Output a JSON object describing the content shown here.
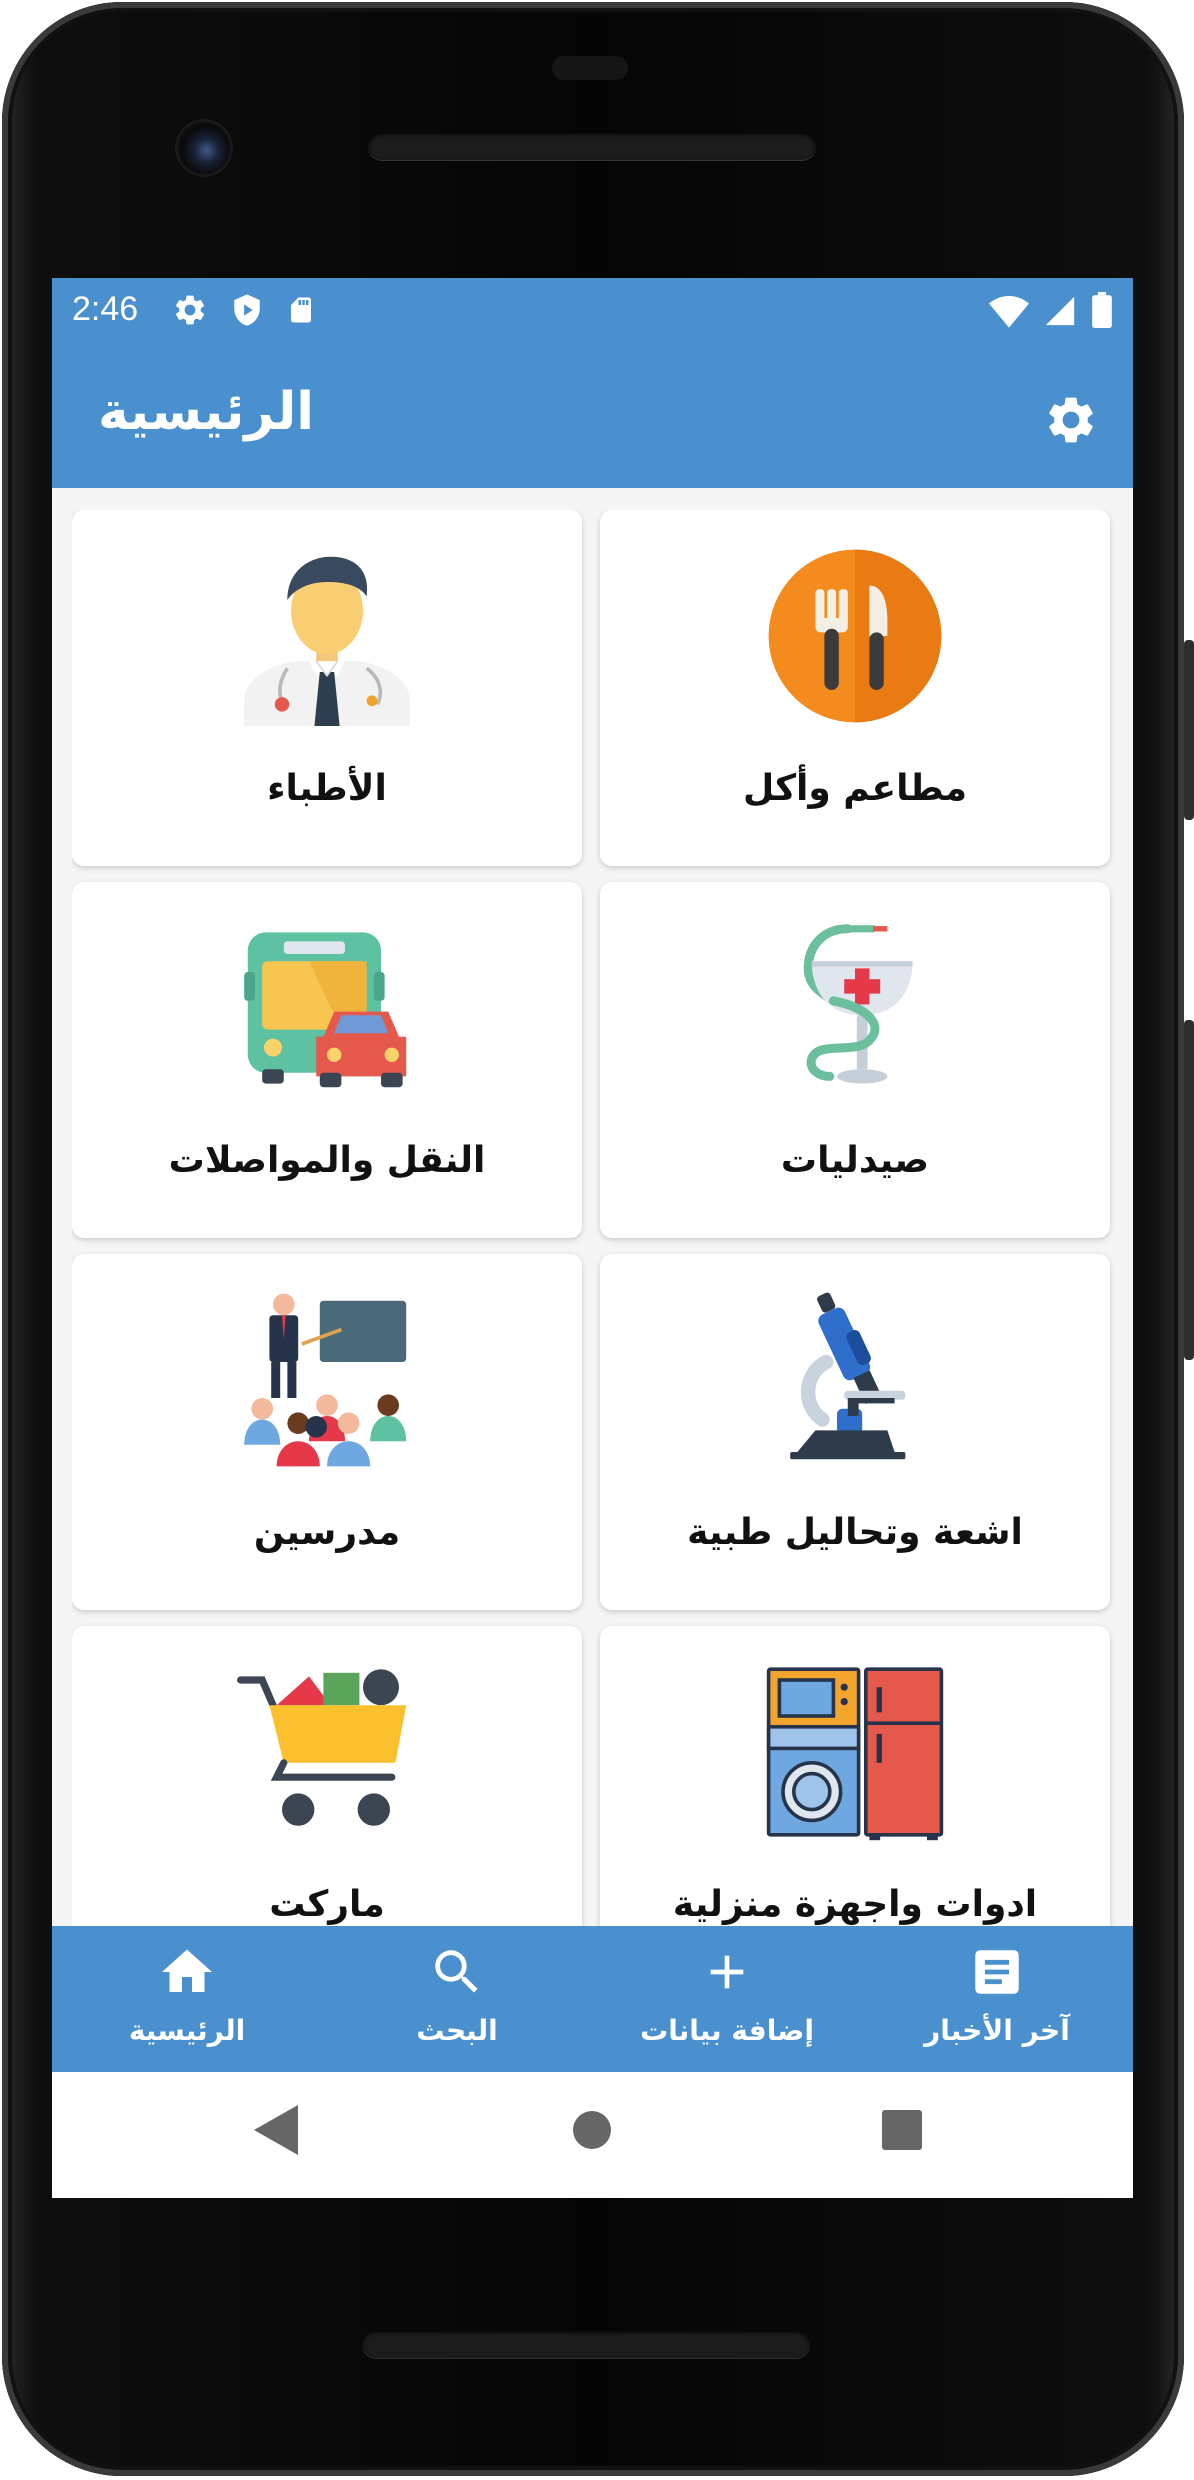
{
  "status_bar": {
    "time": "2:46",
    "left_icons": [
      "settings-icon",
      "shield-play-icon",
      "sd-card-icon"
    ],
    "right_icons": [
      "wifi-icon",
      "signal-icon",
      "battery-icon"
    ]
  },
  "app_bar": {
    "title": "الرئيسية",
    "settings_icon": "gear-icon"
  },
  "categories": [
    {
      "label": "مطاعم وأكل",
      "icon": "fork-knife-icon"
    },
    {
      "label": "الأطباء",
      "icon": "doctor-icon"
    },
    {
      "label": "صيدليات",
      "icon": "pharmacy-icon"
    },
    {
      "label": "النقل والمواصلات",
      "icon": "bus-car-icon"
    },
    {
      "label": "اشعة وتحاليل طبية",
      "icon": "microscope-icon"
    },
    {
      "label": "مدرسين",
      "icon": "teacher-icon"
    },
    {
      "label": "ادوات واجهزة منزلية",
      "icon": "home-appliances-icon"
    },
    {
      "label": "ماركت",
      "icon": "shopping-cart-icon"
    }
  ],
  "bottom_nav": [
    {
      "label": "آخر الأخبار",
      "icon": "article-icon"
    },
    {
      "label": "إضافة بيانات",
      "icon": "plus-icon"
    },
    {
      "label": "البحث",
      "icon": "search-icon"
    },
    {
      "label": "الرئيسية",
      "icon": "home-icon"
    }
  ],
  "system_nav": [
    "back-icon",
    "home-circle-icon",
    "recents-icon"
  ],
  "colors": {
    "primary": "#4a90cf",
    "card_bg": "#ffffff",
    "screen_bg": "#f5f5f5"
  }
}
